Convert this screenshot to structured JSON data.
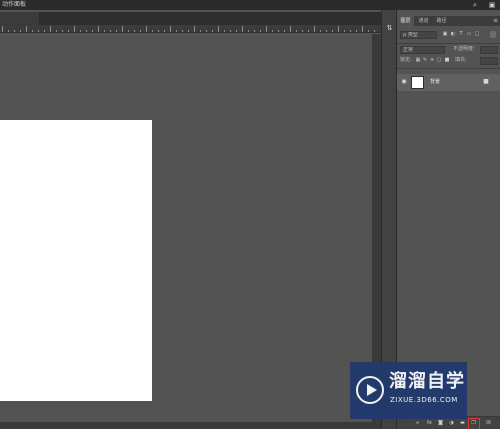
{
  "window": {
    "title": "动作面板",
    "search_icon": "search-icon",
    "workspace_icon": "workspace-icon"
  },
  "right_strip": {
    "icon": "adjust-panel-icon"
  },
  "layers_panel": {
    "tabs": [
      {
        "label": "图层",
        "active": true
      },
      {
        "label": "通道",
        "active": false
      },
      {
        "label": "路径",
        "active": false
      }
    ],
    "menu_icon": "panel-menu-icon",
    "filter": {
      "label": "ρ 类型",
      "icons": [
        "image-filter-icon",
        "adjustment-filter-icon",
        "type-filter-icon",
        "shape-filter-icon",
        "smart-object-filter-icon"
      ]
    },
    "blend_mode": "正常",
    "opacity_label": "不透明度:",
    "lock_label": "锁定:",
    "fill_label": "填充:",
    "layers": [
      {
        "name": "背景",
        "visible": true,
        "locked": true
      }
    ],
    "footer_icons": [
      "link-icon",
      "fx-icon",
      "mask-icon",
      "adjustment-layer-icon",
      "group-folder-icon",
      "new-layer-icon",
      "trash-icon"
    ]
  },
  "watermark": {
    "name": "溜溜自学",
    "url": "ZIXUE.3D66.COM"
  },
  "colors": {
    "workspace": "#535353",
    "panel_dark": "#424242",
    "highlight": "#e0382b",
    "watermark_bg": "#1f3a6e"
  }
}
